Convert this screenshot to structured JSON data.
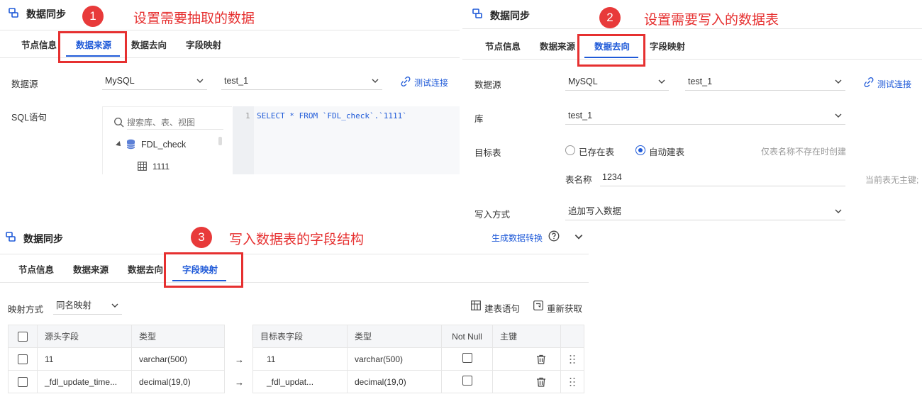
{
  "panel1": {
    "title": "数据同步",
    "badge": "1",
    "annotation": "设置需要抽取的数据",
    "tabs": [
      "节点信息",
      "数据来源",
      "数据去向",
      "字段映射"
    ],
    "active_tab": "数据来源",
    "datasource_label": "数据源",
    "datasource_type": "MySQL",
    "datasource_name": "test_1",
    "test_connection": "测试连接",
    "sql_label": "SQL语句",
    "search_placeholder": "搜索库、表、视图",
    "tree_db": "FDL_check",
    "tree_table": "1111",
    "code_line_number": "1",
    "code_text": "SELECT * FROM `FDL_check`.`1111`"
  },
  "panel2": {
    "title": "数据同步",
    "badge": "2",
    "annotation": "设置需要写入的数据表",
    "tabs": [
      "节点信息",
      "数据来源",
      "数据去向",
      "字段映射"
    ],
    "active_tab": "数据去向",
    "datasource_label": "数据源",
    "datasource_type": "MySQL",
    "datasource_name": "test_1",
    "test_connection": "测试连接",
    "db_label": "库",
    "db_value": "test_1",
    "target_label": "目标表",
    "radio_existing": "已存在表",
    "radio_auto": "自动建表",
    "hint_create": "仅表名称不存在时创建",
    "table_name_label": "表名称",
    "table_name_value": "1234",
    "hint_no_pk": "当前表无主键;",
    "write_mode_label": "写入方式",
    "write_mode_value": "追加写入数据"
  },
  "panel3": {
    "title": "数据同步",
    "badge": "3",
    "annotation": "写入数据表的字段结构",
    "generate_link": "生成数据转换",
    "tabs": [
      "节点信息",
      "数据来源",
      "数据去向",
      "字段映射"
    ],
    "active_tab": "字段映射",
    "mapping_mode_label": "映射方式",
    "mapping_mode_value": "同名映射",
    "create_stmt": "建表语句",
    "refetch": "重新获取",
    "source_headers": [
      "源头字段",
      "类型"
    ],
    "target_headers": [
      "目标表字段",
      "类型",
      "Not Null",
      "主键"
    ],
    "arrow": "→",
    "rows": [
      {
        "src_field": "11",
        "src_type": "varchar(500)",
        "tgt_field": "11",
        "tgt_type": "varchar(500)"
      },
      {
        "src_field": "_fdl_update_time...",
        "src_type": "decimal(19,0)",
        "tgt_field": "_fdl_updat...",
        "tgt_type": "decimal(19,0)"
      }
    ]
  },
  "colors": {
    "accent": "#1f5ad8",
    "annotation_red": "#e63030"
  },
  "icons": [
    "data-sync-icon",
    "chevron-down-icon",
    "link-icon",
    "search-icon",
    "database-icon",
    "table-icon",
    "help-icon",
    "grid-icon",
    "refresh-icon",
    "trash-icon",
    "drag-handle-icon"
  ]
}
